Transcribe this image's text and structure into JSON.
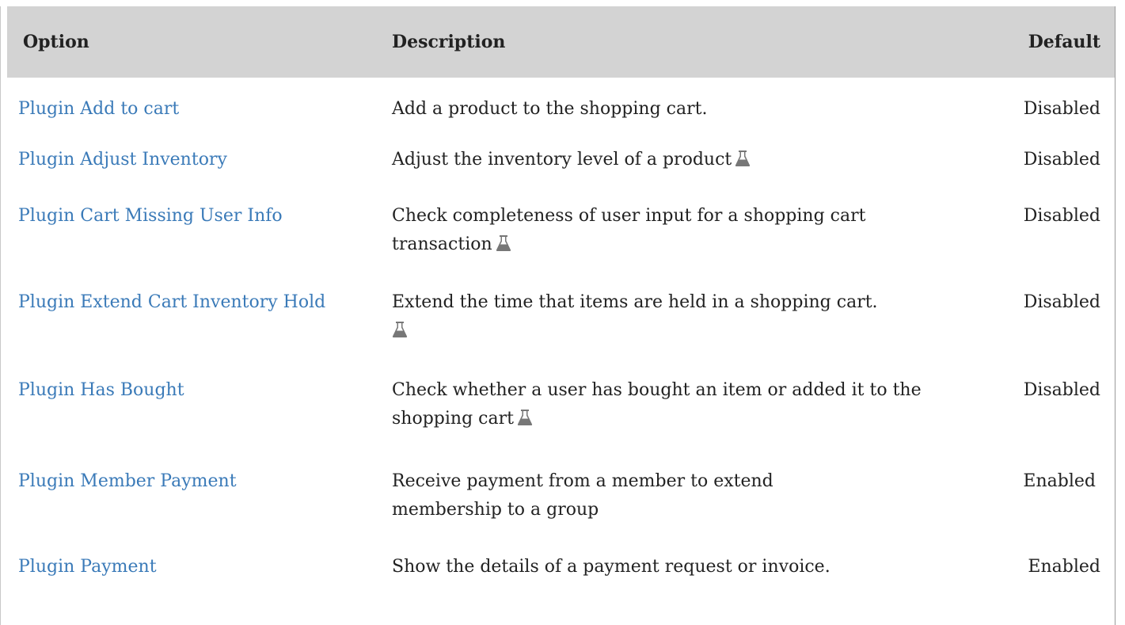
{
  "table": {
    "headers": {
      "option": "Option",
      "description": "Description",
      "default": "Default"
    },
    "rows": [
      {
        "option": "Plugin Add to cart",
        "description": "Add a product to the shopping cart.",
        "experimental": false,
        "default": "Disabled"
      },
      {
        "option": "Plugin Adjust Inventory",
        "description": "Adjust the inventory level of a product",
        "experimental": true,
        "default": "Disabled"
      },
      {
        "option": "Plugin Cart Missing User Info",
        "description": "Check completeness of user input for a shopping cart transaction",
        "experimental": true,
        "default": "Disabled"
      },
      {
        "option": "Plugin Extend Cart Inventory Hold",
        "description": "Extend the time that items are held in a shopping cart.",
        "experimental": true,
        "default": "Disabled"
      },
      {
        "option": "Plugin Has Bought",
        "description": "Check whether a user has bought an item or added it to the shopping cart",
        "experimental": true,
        "default": "Disabled"
      },
      {
        "option": "Plugin Member Payment",
        "description": "Receive payment from a member to extend membership to a group",
        "experimental": false,
        "default": "Enabled"
      },
      {
        "option": "Plugin Payment",
        "description": "Show the details of a payment request or invoice.",
        "experimental": false,
        "default": "Enabled"
      }
    ]
  },
  "icons": {
    "experimental": "flask-icon"
  },
  "colors": {
    "link": "#3a7ab8",
    "header_bg": "#d3d3d3",
    "icon": "#777777"
  }
}
